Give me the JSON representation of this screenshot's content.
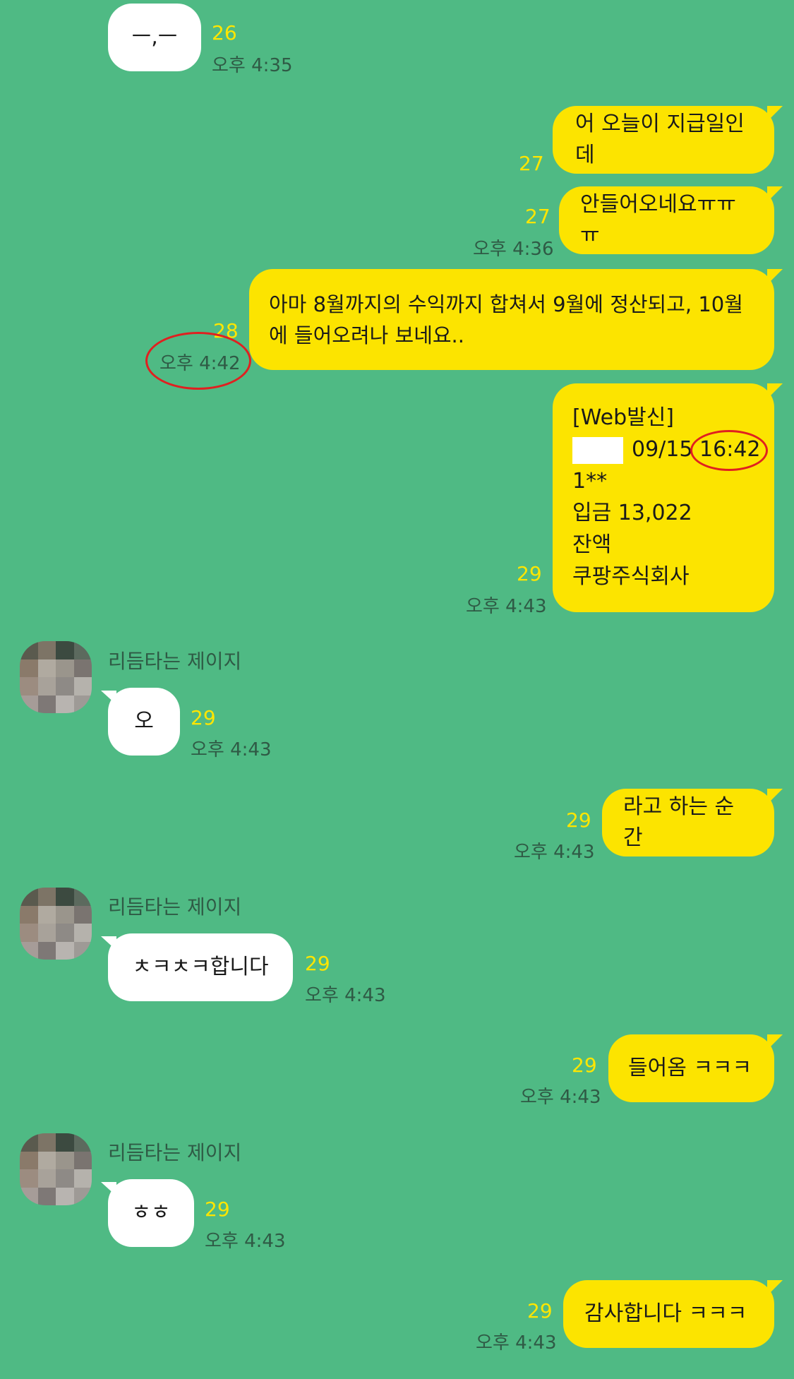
{
  "colors": {
    "background": "#4fba84",
    "outgoing_bubble": "#fce400",
    "incoming_bubble": "#ffffff",
    "unread_count": "#ffe600",
    "annotation_circle": "#e02020"
  },
  "contact_name": "리듬타는 제이지",
  "messages": [
    {
      "text": "ㅡ,ㅡ",
      "unread": "26",
      "time": "오후 4:35"
    },
    {
      "text": "어 오늘이 지급일인데",
      "unread": "27",
      "time": ""
    },
    {
      "text": "안들어오네요ㅠㅠㅠ",
      "unread": "27",
      "time": "오후 4:36"
    },
    {
      "line1": "아마 8월까지의 수익까지 합쳐서 9월에 정산되고, 10월",
      "line2": "에 들어오려나 보네요..",
      "unread": "28",
      "time": "오후 4:42"
    },
    {
      "header": "[Web발신]",
      "date": "09/15",
      "clock": "16:42",
      "account": "1**",
      "deposit": "입금 13,022",
      "balance": "잔액",
      "company": "쿠팡주식회사",
      "unread": "29",
      "time": "오후 4:43"
    },
    {
      "text": "오",
      "unread": "29",
      "time": "오후 4:43"
    },
    {
      "text": "라고 하는 순간",
      "unread": "29",
      "time": "오후 4:43"
    },
    {
      "text": "ㅊㅋㅊㅋ합니다",
      "unread": "29",
      "time": "오후 4:43"
    },
    {
      "text": "들어옴 ㅋㅋㅋ",
      "unread": "29",
      "time": "오후 4:43"
    },
    {
      "text": "ㅎㅎ",
      "unread": "29",
      "time": "오후 4:43"
    },
    {
      "text": "감사합니다 ㅋㅋㅋ",
      "unread": "29",
      "time": "오후 4:43"
    }
  ]
}
